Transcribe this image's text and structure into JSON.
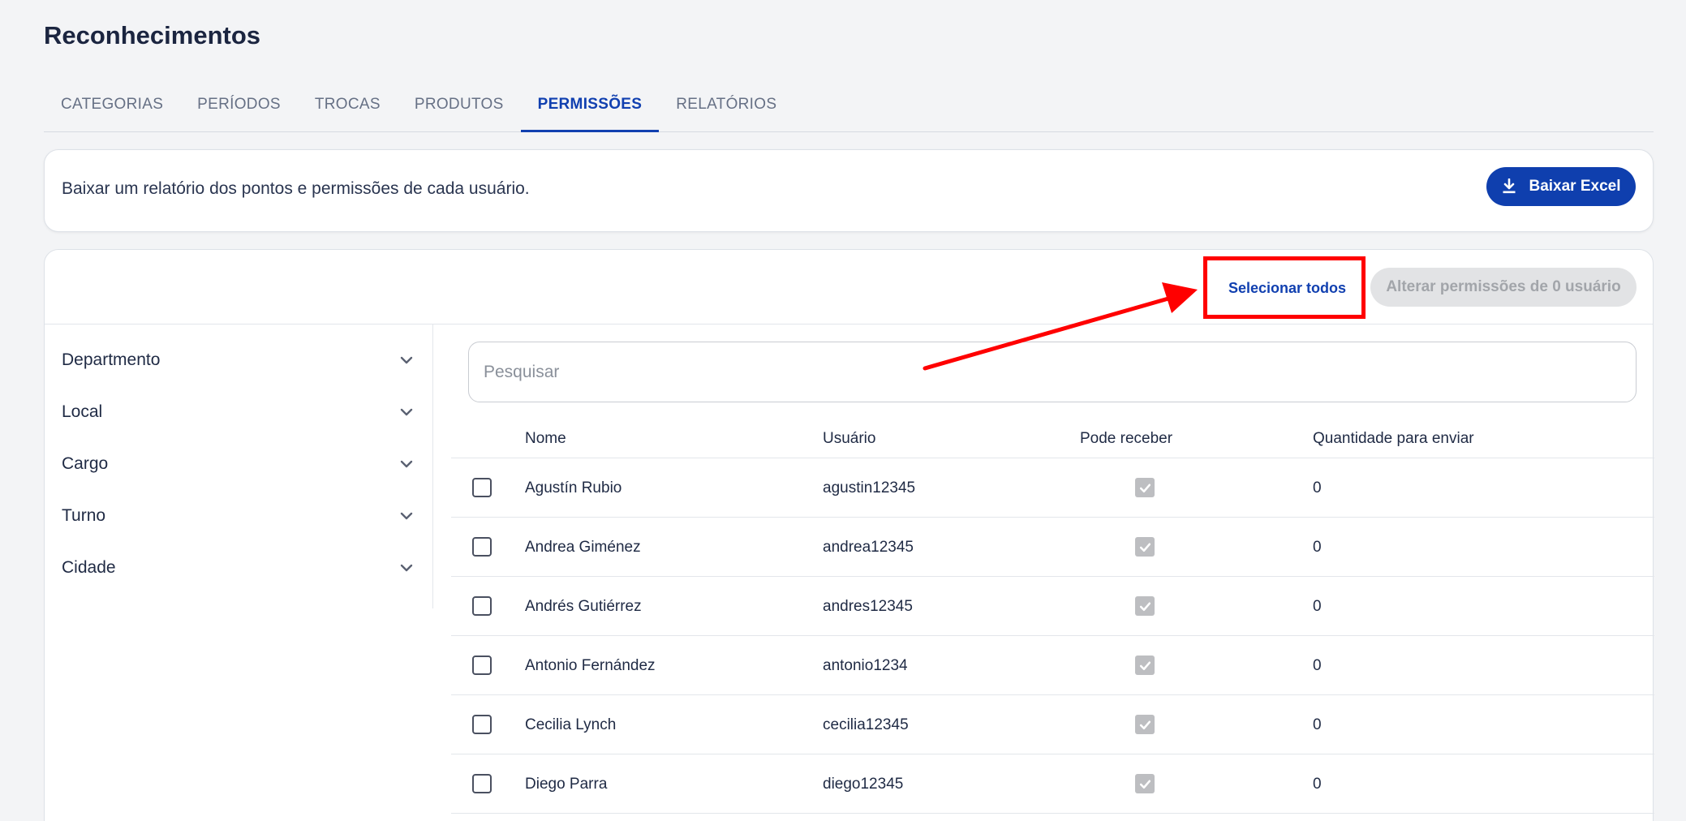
{
  "page": {
    "title": "Reconhecimentos"
  },
  "tabs": [
    {
      "label": "CATEGORIAS"
    },
    {
      "label": "PERÍODOS"
    },
    {
      "label": "TROCAS"
    },
    {
      "label": "PRODUTOS"
    },
    {
      "label": "PERMISSÕES",
      "active": true
    },
    {
      "label": "RELATÓRIOS"
    }
  ],
  "report": {
    "text": "Baixar um relatório dos pontos e permissões de cada usuário.",
    "button_label": "Baixar Excel",
    "button_icon": "download-icon"
  },
  "toolbar": {
    "select_all_label": "Selecionar todos",
    "alter_label": "Alterar permissões de 0 usuário"
  },
  "filters": [
    {
      "label": "Departmento"
    },
    {
      "label": "Local"
    },
    {
      "label": "Cargo"
    },
    {
      "label": "Turno"
    },
    {
      "label": "Cidade"
    }
  ],
  "search": {
    "placeholder": "Pesquisar",
    "value": ""
  },
  "table": {
    "headers": {
      "name": "Nome",
      "user": "Usuário",
      "receive": "Pode receber",
      "qty": "Quantidade para enviar"
    },
    "rows": [
      {
        "name": "Agustín Rubio",
        "user": "agustin12345",
        "receive": true,
        "qty": "0"
      },
      {
        "name": "Andrea Giménez",
        "user": "andrea12345",
        "receive": true,
        "qty": "0"
      },
      {
        "name": "Andrés Gutiérrez",
        "user": "andres12345",
        "receive": true,
        "qty": "0"
      },
      {
        "name": "Antonio Fernández",
        "user": "antonio1234",
        "receive": true,
        "qty": "0"
      },
      {
        "name": "Cecilia Lynch",
        "user": "cecilia12345",
        "receive": true,
        "qty": "0"
      },
      {
        "name": "Diego Parra",
        "user": "diego12345",
        "receive": true,
        "qty": "0"
      }
    ]
  },
  "colors": {
    "accent": "#1140b0",
    "annotation": "#ff0000",
    "disabled_bg": "#e2e3e5"
  }
}
